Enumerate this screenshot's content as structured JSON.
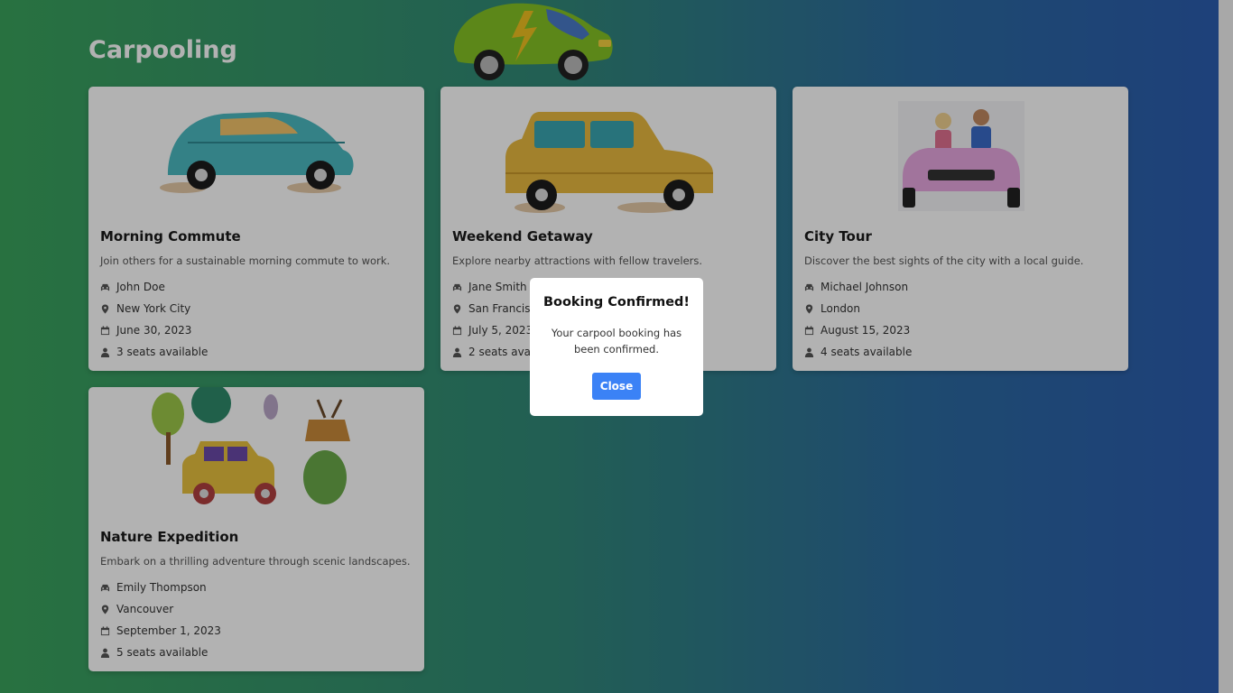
{
  "page": {
    "title": "Carpooling"
  },
  "cards": [
    {
      "title": "Morning Commute",
      "description": "Join others for a sustainable morning commute to work.",
      "driver": "John Doe",
      "location": "New York City",
      "date": "June 30, 2023",
      "seats": "3 seats available",
      "image_icon": "teal-beetle-car"
    },
    {
      "title": "Weekend Getaway",
      "description": "Explore nearby attractions with fellow travelers.",
      "driver": "Jane Smith",
      "location": "San Francisco",
      "date": "July 5, 2023",
      "seats": "2 seats available",
      "image_icon": "yellow-station-wagon"
    },
    {
      "title": "City Tour",
      "description": "Discover the best sights of the city with a local guide.",
      "driver": "Michael Johnson",
      "location": "London",
      "date": "August 15, 2023",
      "seats": "4 seats available",
      "image_icon": "pink-convertible-with-couple"
    },
    {
      "title": "Nature Expedition",
      "description": "Embark on a thrilling adventure through scenic landscapes.",
      "driver": "Emily Thompson",
      "location": "Vancouver",
      "date": "September 1, 2023",
      "seats": "5 seats available",
      "image_icon": "yellow-car-forest-animals"
    }
  ],
  "modal": {
    "title": "Booking Confirmed!",
    "message": "Your carpool booking has been confirmed.",
    "close_label": "Close"
  },
  "icons": {
    "driver": "car-icon",
    "location": "map-pin-icon",
    "date": "calendar-icon",
    "seats": "user-icon"
  },
  "colors": {
    "gradient_start": "#3aa35c",
    "gradient_end": "#2c5cb0",
    "accent": "#3b82f6",
    "icon": "#555555"
  }
}
